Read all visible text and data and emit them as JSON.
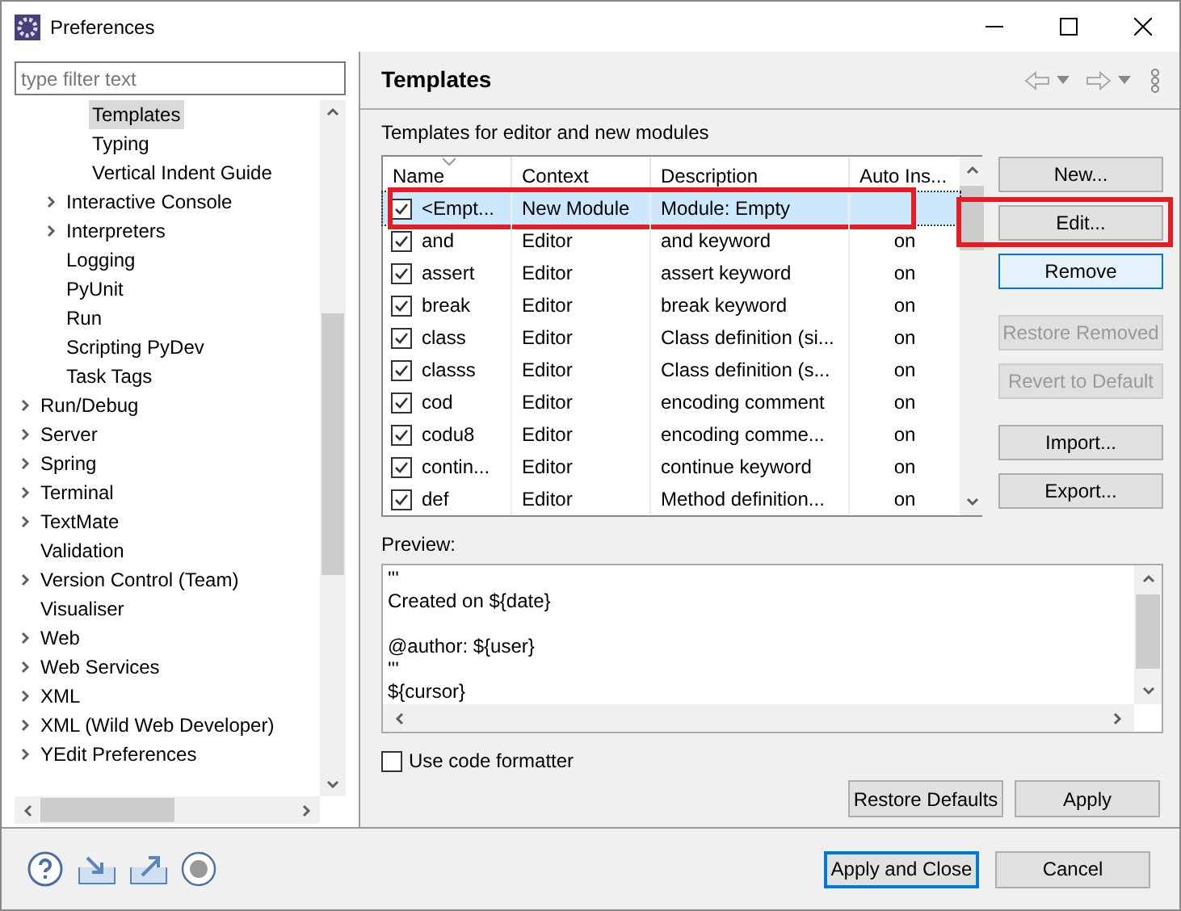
{
  "window": {
    "title": "Preferences"
  },
  "filter": {
    "placeholder": "type filter text"
  },
  "tree": [
    {
      "children": [
        {
          "children": [
            {
              "label": "Templates",
              "expandable": false,
              "selected": true
            },
            {
              "label": "Typing",
              "expandable": false,
              "selected": false
            },
            {
              "label": "Vertical Indent Guide",
              "expandable": false,
              "selected": false
            }
          ]
        },
        {
          "label": "Interactive Console",
          "expandable": true,
          "selected": false
        },
        {
          "label": "Interpreters",
          "expandable": true,
          "selected": false
        },
        {
          "label": "Logging",
          "expandable": false,
          "selected": false
        },
        {
          "label": "PyUnit",
          "expandable": false,
          "selected": false
        },
        {
          "label": "Run",
          "expandable": false,
          "selected": false
        },
        {
          "label": "Scripting PyDev",
          "expandable": false,
          "selected": false
        },
        {
          "label": "Task Tags",
          "expandable": false,
          "selected": false
        }
      ]
    },
    {
      "label": "Run/Debug",
      "expandable": true,
      "selected": false
    },
    {
      "label": "Server",
      "expandable": true,
      "selected": false
    },
    {
      "label": "Spring",
      "expandable": true,
      "selected": false
    },
    {
      "label": "Terminal",
      "expandable": true,
      "selected": false
    },
    {
      "label": "TextMate",
      "expandable": true,
      "selected": false
    },
    {
      "label": "Validation",
      "expandable": false,
      "selected": false
    },
    {
      "label": "Version Control (Team)",
      "expandable": true,
      "selected": false
    },
    {
      "label": "Visualiser",
      "expandable": false,
      "selected": false
    },
    {
      "label": "Web",
      "expandable": true,
      "selected": false
    },
    {
      "label": "Web Services",
      "expandable": true,
      "selected": false
    },
    {
      "label": "XML",
      "expandable": true,
      "selected": false
    },
    {
      "label": "XML (Wild Web Developer)",
      "expandable": true,
      "selected": false
    },
    {
      "label": "YEdit Preferences",
      "expandable": true,
      "selected": false
    }
  ],
  "page": {
    "title": "Templates",
    "subtitle": "Templates for editor and new modules"
  },
  "table": {
    "columns": [
      "Name",
      "Context",
      "Description",
      "Auto Ins..."
    ],
    "rows": [
      {
        "checked": true,
        "selected": true,
        "highlighted": true,
        "cells": [
          "<Empt...",
          "New Module",
          "Module: Empty",
          ""
        ]
      },
      {
        "checked": true,
        "selected": false,
        "highlighted": false,
        "cells": [
          "and",
          "Editor",
          "and keyword",
          "on"
        ]
      },
      {
        "checked": true,
        "selected": false,
        "highlighted": false,
        "cells": [
          "assert",
          "Editor",
          "assert keyword",
          "on"
        ]
      },
      {
        "checked": true,
        "selected": false,
        "highlighted": false,
        "cells": [
          "break",
          "Editor",
          "break keyword",
          "on"
        ]
      },
      {
        "checked": true,
        "selected": false,
        "highlighted": false,
        "cells": [
          "class",
          "Editor",
          "Class definition (si...",
          "on"
        ]
      },
      {
        "checked": true,
        "selected": false,
        "highlighted": false,
        "cells": [
          "classs",
          "Editor",
          "Class definition (s...",
          "on"
        ]
      },
      {
        "checked": true,
        "selected": false,
        "highlighted": false,
        "cells": [
          "cod",
          "Editor",
          "encoding comment",
          "on"
        ]
      },
      {
        "checked": true,
        "selected": false,
        "highlighted": false,
        "cells": [
          "codu8",
          "Editor",
          "encoding comme...",
          "on"
        ]
      },
      {
        "checked": true,
        "selected": false,
        "highlighted": false,
        "cells": [
          "contin...",
          "Editor",
          "continue keyword",
          "on"
        ]
      },
      {
        "checked": true,
        "selected": false,
        "highlighted": false,
        "cells": [
          "def",
          "Editor",
          "Method definition...",
          "on"
        ]
      }
    ]
  },
  "side_buttons": [
    {
      "label": "New...",
      "disabled": false,
      "focused": false,
      "highlighted": false
    },
    {
      "label": "Edit...",
      "disabled": false,
      "focused": false,
      "highlighted": true
    },
    {
      "label": "Remove",
      "disabled": false,
      "focused": true,
      "highlighted": false
    },
    {
      "label": "Restore Removed",
      "disabled": true,
      "focused": false,
      "highlighted": false
    },
    {
      "label": "Revert to Default",
      "disabled": true,
      "focused": false,
      "highlighted": false
    },
    {
      "label": "Import...",
      "disabled": false,
      "focused": false,
      "highlighted": false
    },
    {
      "label": "Export...",
      "disabled": false,
      "focused": false,
      "highlighted": false
    }
  ],
  "preview": {
    "label": "Preview:",
    "lines": [
      {
        "text": "'''",
        "gap_after": false
      },
      {
        "text": "Created on ${date}",
        "gap_after": true
      },
      {
        "text": "@author: ${user}",
        "gap_after": false
      },
      {
        "text": "'''",
        "gap_after": false
      },
      {
        "text": "${cursor}",
        "gap_after": false
      }
    ]
  },
  "use_code_formatter": {
    "label": "Use code formatter",
    "checked": false
  },
  "page_buttons": [
    "Restore Defaults",
    "Apply"
  ],
  "dialog_buttons": [
    {
      "label": "Apply and Close",
      "default": true
    },
    {
      "label": "Cancel",
      "default": false
    }
  ]
}
